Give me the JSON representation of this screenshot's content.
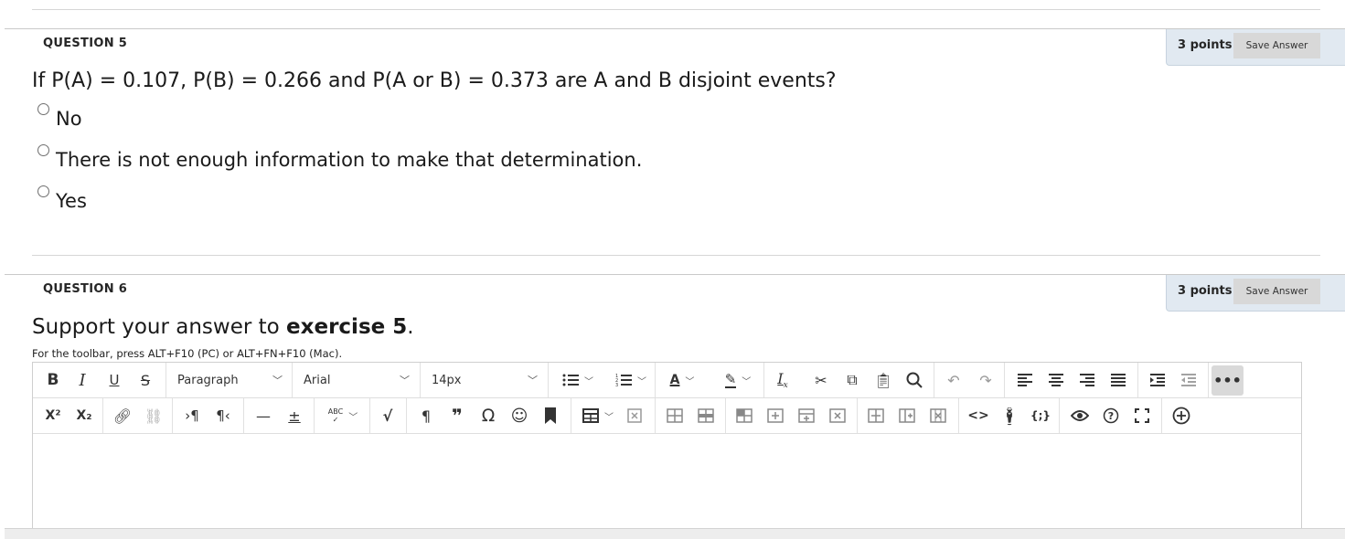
{
  "question5": {
    "header": "QUESTION 5",
    "points": "3 points",
    "save_label": "Save Answer",
    "text": "If P(A) = 0.107, P(B) = 0.266 and P(A or B) = 0.373 are A and B disjoint events?",
    "options": [
      {
        "label": "No"
      },
      {
        "label": "There is not enough information to make that determination."
      },
      {
        "label": "Yes"
      }
    ]
  },
  "question6": {
    "header": "QUESTION 6",
    "points": "3 points",
    "save_label": "Save Answer",
    "text_prefix": "Support your answer to ",
    "text_bold": "exercise 5",
    "text_suffix": ".",
    "hint": "For the toolbar, press ALT+F10 (PC) or ALT+FN+F10 (Mac)."
  },
  "toolbar": {
    "row1": {
      "bold": "B",
      "italic": "I",
      "underline": "U",
      "strike": "S",
      "block_format": "Paragraph",
      "font_family": "Arial",
      "font_size": "14px",
      "more": "•••"
    },
    "row2": {
      "superscript": "X²",
      "subscript": "X₂",
      "spellcheck": "ABC",
      "code": "<>",
      "source_code": "{;}"
    }
  }
}
